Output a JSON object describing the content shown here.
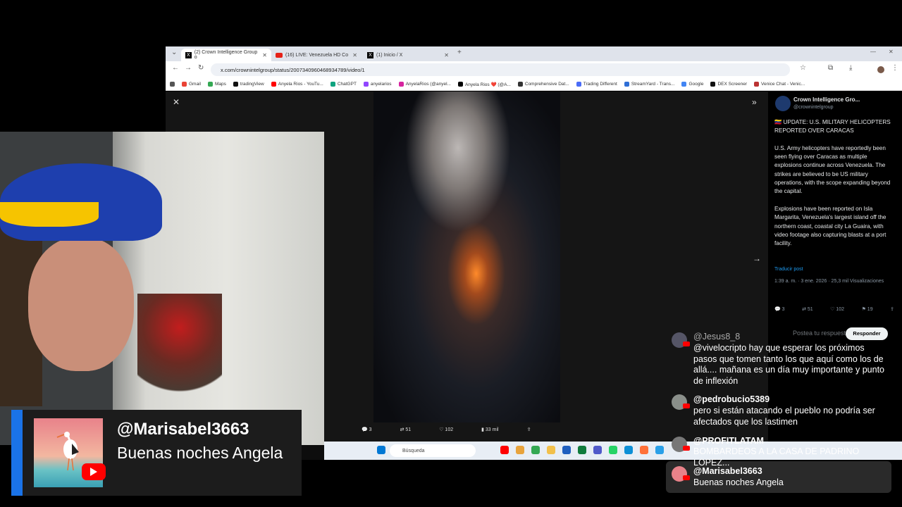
{
  "browser": {
    "tabs": [
      {
        "label": "(2) Crown Intelligence Group o"
      },
      {
        "label": "(16) LIVE: Venezuela HD Co"
      },
      {
        "label": "(1) Inicio / X"
      }
    ],
    "url": "x.com/crownintelgroup/status/2007340960468934789/video/1",
    "bookmarks": [
      "Gmail",
      "Maps",
      "tradingView",
      "Anyela Rios - YouTu...",
      "ChatGPT",
      "anyelarios",
      "AnyelaRios (@anyel...",
      "Anyela Rios ❤️ (@A...",
      "Comprehensive Dat...",
      "Trading Different",
      "StreamYard - Trans...",
      "Google",
      "DEX Screener",
      "Venice Chat - Venic..."
    ]
  },
  "video": {
    "actions": {
      "replies": "3",
      "reposts": "51",
      "likes": "102",
      "views": "33 mil"
    }
  },
  "tweet": {
    "name": "Crown Intelligence Gro...",
    "handle": "@crownintelgroup",
    "text": "🇻🇪 UPDATE: U.S. MILITARY HELICOPTERS REPORTED OVER CARACAS\n\nU.S. Army helicopters have reportedly been seen flying over Caracas as multiple explosions continue across Venezuela. The strikes are believed to be US military operations, with the scope expanding beyond the capital.\n\nExplosions have been reported on Isla Margarita, Venezuela's largest island off the northern coast, coastal city La Guaira, with video footage also capturing blasts at a port facility.",
    "translate": "Traducir post",
    "meta": "1:39 a. m. · 3 ene. 2026 · 25,3 mil Visualizaciones",
    "actions": {
      "replies": "3",
      "reposts": "51",
      "likes": "102",
      "bookmarks": "19"
    },
    "reply_placeholder": "Postea tu respuesta",
    "reply_button": "Responder"
  },
  "taskbar": {
    "search_placeholder": "Búsqueda"
  },
  "lower_third": {
    "username": "@Marisabel3663",
    "message": "Buenas noches Angela"
  },
  "chat": [
    {
      "user": "@Jesus8_8",
      "text": "@vivelocripto hay que esperar los próximos pasos que tomen tanto los que aquí como los de allá.... mañana es un día muy importante y punto de inflexión"
    },
    {
      "user": "@pedrobucio5389",
      "text": "pero si están atacando el pueblo no podría ser afectados que los lastimen"
    },
    {
      "user": "@PROFITLATAM",
      "text": "BOMBARDEOS A LA CASA DE PADRINO LOPEZ..."
    },
    {
      "user": "@Marisabel3663",
      "text": "Buenas noches Angela"
    }
  ],
  "colors": {
    "accent": "#1a73e8",
    "youtube_red": "#ff0000",
    "link_blue": "#1d9bf0"
  }
}
